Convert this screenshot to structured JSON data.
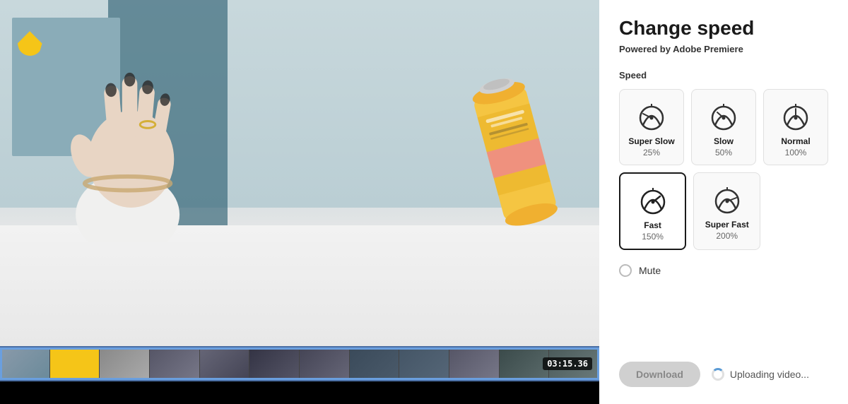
{
  "header": {
    "title": "Change speed",
    "subtitle_prefix": "Powered by ",
    "subtitle_brand": "Adobe Premiere"
  },
  "speed_section": {
    "label": "Speed",
    "cards": [
      {
        "id": "super-slow",
        "name": "Super Slow",
        "pct": "25%",
        "selected": false,
        "icon": "super-slow"
      },
      {
        "id": "slow",
        "name": "Slow",
        "pct": "50%",
        "selected": false,
        "icon": "slow"
      },
      {
        "id": "normal",
        "name": "Normal",
        "pct": "100%",
        "selected": false,
        "icon": "normal"
      },
      {
        "id": "fast",
        "name": "Fast",
        "pct": "150%",
        "selected": true,
        "icon": "fast"
      },
      {
        "id": "super-fast",
        "name": "Super Fast",
        "pct": "200%",
        "selected": false,
        "icon": "super-fast"
      }
    ]
  },
  "mute": {
    "label": "Mute",
    "checked": false
  },
  "actions": {
    "download_label": "Download",
    "uploading_label": "Uploading video..."
  },
  "timeline": {
    "timecode": "03:15.36"
  }
}
